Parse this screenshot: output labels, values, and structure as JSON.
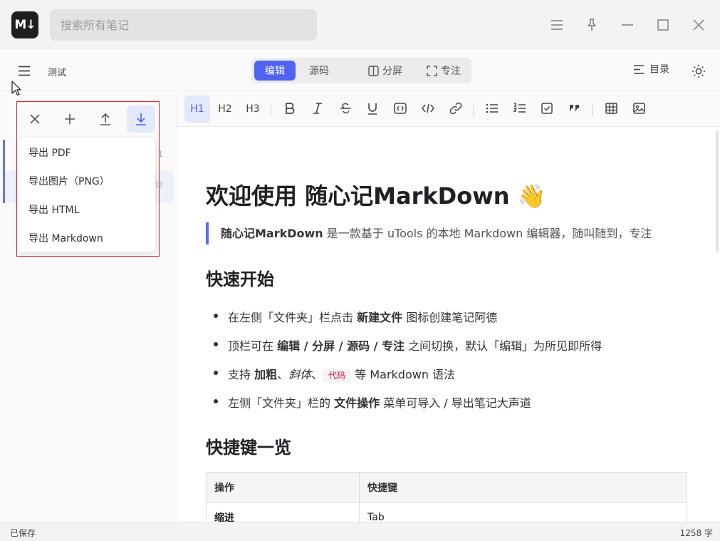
{
  "app": {
    "logo_text": "M↓"
  },
  "search": {
    "placeholder": "搜索所有笔记"
  },
  "note": {
    "title": "测试"
  },
  "modes": [
    {
      "label": "编辑",
      "icon": "",
      "active": true
    },
    {
      "label": "源码",
      "icon": "",
      "active": false
    },
    {
      "label": "分屏",
      "icon": "split-icon",
      "active": false
    },
    {
      "label": "专注",
      "icon": "focus-icon",
      "active": false
    }
  ],
  "toc": {
    "label": "目录"
  },
  "sidebar": {
    "rows": [
      {
        "meta": "1"
      },
      {
        "meta": "02"
      }
    ]
  },
  "export_menu": {
    "items": [
      "导出 PDF",
      "导出图片（PNG）",
      "导出 HTML",
      "导出 Markdown"
    ]
  },
  "format_toolbar": {
    "headings": [
      "H1",
      "H2",
      "H3"
    ],
    "active": "H1",
    "buttons": [
      "bold-icon",
      "italic-icon",
      "strikethrough-icon",
      "underline-icon",
      "inline-code-icon",
      "code-block-icon",
      "link-icon",
      "bullet-list-icon",
      "ordered-list-icon",
      "task-list-icon",
      "quote-icon",
      "table-icon",
      "image-icon"
    ]
  },
  "document": {
    "h1": "欢迎使用 随心记MarkDown 👋",
    "quote_bold": "随心记MarkDown",
    "quote_rest": " 是一款基于 uTools 的本地 Markdown 编辑器，随叫随到，专注",
    "h2_start": "快速开始",
    "list": {
      "i1_pre": "在左侧「文件夹」栏点击 ",
      "i1_bold": "新建文件",
      "i1_post": " 图标创建笔记阿德",
      "i2_pre": "顶栏可在 ",
      "i2_bold": "编辑 / 分屏 / 源码 / 专注",
      "i2_post": " 之间切换，默认「编辑」为所见即所得",
      "i3_pre": "支持 ",
      "i3_bold": "加粗",
      "i3_sep1": "、",
      "i3_italic": "斜体",
      "i3_sep2": "、",
      "i3_code": "代码",
      "i3_post": " 等 Markdown 语法",
      "i4_pre": "左侧「文件夹」栏的 ",
      "i4_bold": "文件操作",
      "i4_post": " 菜单可导入 / 导出笔记大声道"
    },
    "h2_shortcuts": "快捷键一览",
    "table": {
      "headers": [
        "操作",
        "快捷键"
      ],
      "rows": [
        [
          "缩进",
          "Tab"
        ]
      ]
    }
  },
  "status": {
    "saved": "已保存",
    "count": "1258 字"
  }
}
